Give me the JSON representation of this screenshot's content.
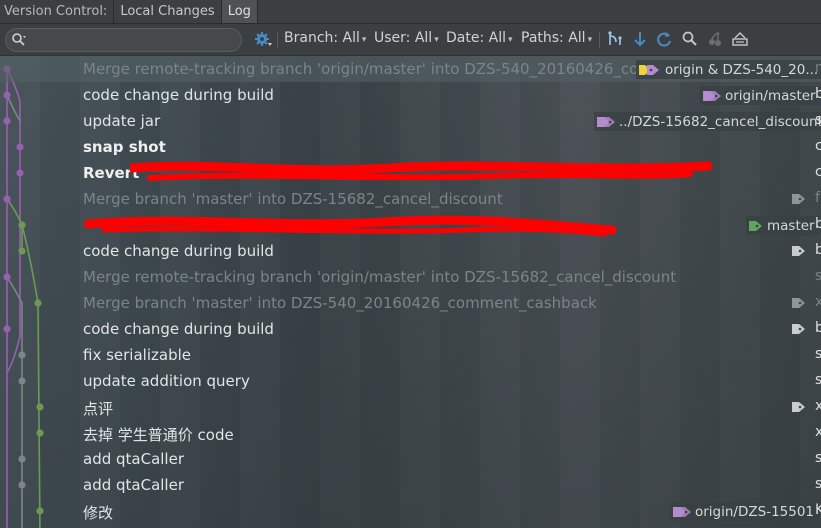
{
  "tabs": {
    "label": "Version Control:",
    "items": [
      "Local Changes",
      "Log"
    ],
    "active": "Log"
  },
  "toolbar": {
    "search_placeholder": "",
    "branch": "Branch: All",
    "user": "User: All",
    "date": "Date: All",
    "paths": "Paths: All",
    "icons": [
      "gear-icon",
      "branch-structure-icon",
      "go-to-commit-icon",
      "refresh-icon",
      "search-icon",
      "cherry-pick-icon",
      "intellisort-icon"
    ]
  },
  "commits": [
    {
      "subject": "Merge remote-tracking branch 'origin/master' into DZS-540_20160426_comme",
      "style": "dim-selected",
      "refs": [
        "origin & DZS-540_20..."
      ],
      "author": "n"
    },
    {
      "subject": "code change during build",
      "style": "normal",
      "refs": [
        "origin/master"
      ],
      "author": "b"
    },
    {
      "subject": "update jar",
      "style": "normal",
      "refs": [
        "../DZS-15682_cancel_discount"
      ],
      "author": "s"
    },
    {
      "subject": "snap shot",
      "style": "bold",
      "refs": [],
      "author": "c"
    },
    {
      "subject": "Revert \"\"",
      "style": "bold",
      "refs": [],
      "author": "c"
    },
    {
      "subject": "Merge branch 'master' into DZS-15682_cancel_discount",
      "style": "dim",
      "refs": [],
      "tag_icon": true,
      "author": "f"
    },
    {
      "subject": "",
      "style": "normal",
      "refs": [
        "master"
      ],
      "author": "b"
    },
    {
      "subject": "code change during build",
      "style": "normal",
      "refs": [],
      "tag_icon": true,
      "author": "b"
    },
    {
      "subject": "Merge remote-tracking branch 'origin/master' into DZS-15682_cancel_discount",
      "style": "dim",
      "refs": [],
      "author": "s"
    },
    {
      "subject": "Merge branch 'master' into DZS-540_20160426_comment_cashback",
      "style": "dim",
      "refs": [],
      "tag_icon": true,
      "author": "x"
    },
    {
      "subject": "code change during build",
      "style": "normal",
      "refs": [],
      "tag_icon": true,
      "author": "b"
    },
    {
      "subject": "fix serializable",
      "style": "normal",
      "refs": [],
      "author": "s"
    },
    {
      "subject": "update addition query",
      "style": "normal",
      "refs": [],
      "author": "s"
    },
    {
      "subject": "点评",
      "style": "normal",
      "refs": [],
      "tag_icon": true,
      "author": "x"
    },
    {
      "subject": "去掉 学生普通价 code",
      "style": "normal",
      "refs": [],
      "author": "x"
    },
    {
      "subject": "add qtaCaller",
      "style": "normal",
      "refs": [],
      "author": "s"
    },
    {
      "subject": "add qtaCaller",
      "style": "normal",
      "refs": [],
      "author": "s"
    },
    {
      "subject": "修改",
      "style": "normal",
      "refs": [
        "origin/DZS-15501"
      ],
      "author": "K"
    }
  ],
  "colors": {
    "purple": "#9a5fb0",
    "green": "#6c9a55",
    "gray": "#7c8689",
    "redact": "#ff0000",
    "ref_tag_remote": "#b58bd0",
    "ref_tag_local": "#5fa55f"
  }
}
